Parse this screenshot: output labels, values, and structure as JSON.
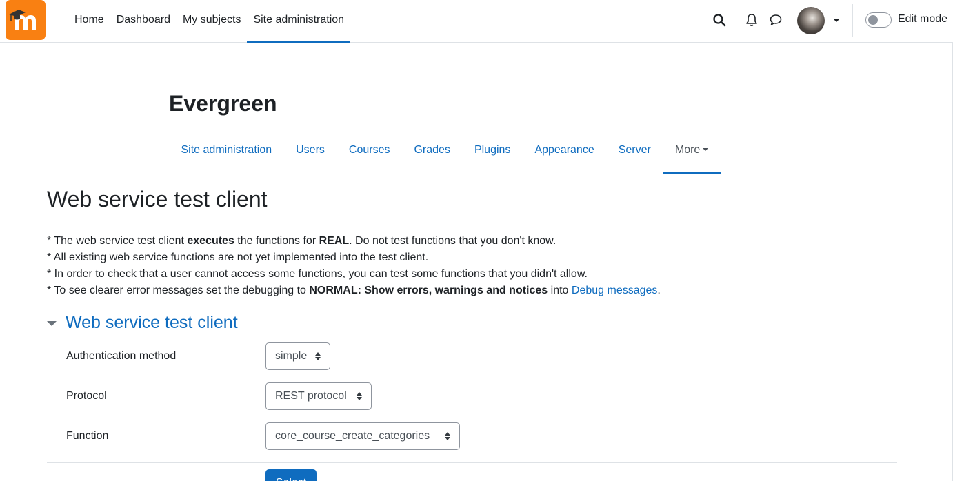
{
  "navbar": {
    "logo_icon": "moodle-logo-icon",
    "brand_color": "#f98012",
    "primary_items": [
      {
        "label": "Home",
        "active": false
      },
      {
        "label": "Dashboard",
        "active": false
      },
      {
        "label": "My subjects",
        "active": false
      },
      {
        "label": "Site administration",
        "active": true
      }
    ],
    "icons": [
      "search-icon",
      "bell-icon",
      "chat-icon"
    ],
    "edit_mode_label": "Edit mode",
    "edit_mode_on": false
  },
  "header": {
    "site_title": "Evergreen",
    "secondary_nav": [
      {
        "label": "Site administration"
      },
      {
        "label": "Users"
      },
      {
        "label": "Courses"
      },
      {
        "label": "Grades"
      },
      {
        "label": "Plugins"
      },
      {
        "label": "Appearance"
      },
      {
        "label": "Server"
      },
      {
        "label": "More",
        "active": true
      }
    ]
  },
  "page": {
    "heading": "Web service test client",
    "notes": {
      "line1_a": "* The web service test client ",
      "line1_b": "executes",
      "line1_c": " the functions for ",
      "line1_d": "REAL",
      "line1_e": ". Do not test functions that you don't know.",
      "line2": "* All existing web service functions are not yet implemented into the test client.",
      "line3": "* In order to check that a user cannot access some functions, you can test some functions that you didn't allow.",
      "line4_a": "* To see clearer error messages set the debugging to ",
      "line4_b": "NORMAL: Show errors, warnings and notices",
      "line4_c": " into ",
      "line4_link": "Debug messages",
      "line4_d": "."
    }
  },
  "form": {
    "legend": "Web service test client",
    "fields": {
      "auth": {
        "label": "Authentication method",
        "value": "simple"
      },
      "protocol": {
        "label": "Protocol",
        "value": "REST protocol"
      },
      "function": {
        "label": "Function",
        "value": "core_course_create_categories"
      }
    },
    "submit_label": "Select"
  },
  "colors": {
    "link": "#0f6cbf",
    "text": "#1d2125",
    "border": "#dee2e6"
  }
}
